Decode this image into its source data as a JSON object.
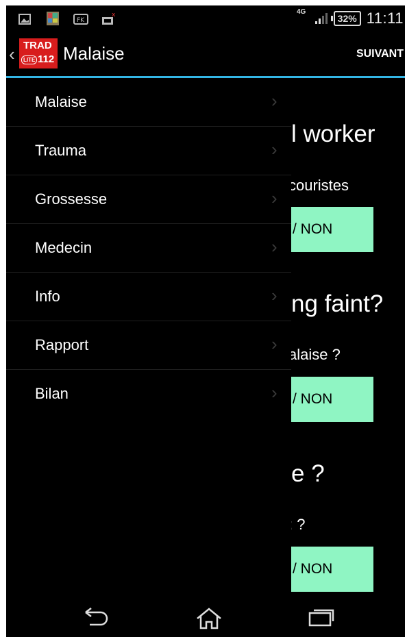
{
  "status_bar": {
    "network_type": "4G",
    "battery": "32%",
    "time": "11:11",
    "icons": [
      "image-icon",
      "gallery-icon",
      "fk-app-icon",
      "camera-error-icon",
      "signal-icon"
    ]
  },
  "action_bar": {
    "logo_top": "TRAD",
    "logo_lite": "LITE",
    "logo_number": "112",
    "title": "Malaise",
    "next_label": "SUIVANT"
  },
  "drawer": {
    "items": [
      {
        "label": "Malaise"
      },
      {
        "label": "Trauma"
      },
      {
        "label": "Grossesse"
      },
      {
        "label": "Medecin"
      },
      {
        "label": "Info"
      },
      {
        "label": "Rapport"
      },
      {
        "label": "Bilan"
      }
    ]
  },
  "content": {
    "questions": [
      {
        "title": "l worker",
        "subtitle": "couristes",
        "button": "/ NON"
      },
      {
        "title": "ng faint?",
        "subtitle": "alaise ?",
        "button": "/ NON"
      },
      {
        "title": "e ?",
        "subtitle": "; ?",
        "button": "/ NON"
      }
    ]
  },
  "nav_bar": {
    "icons": [
      "back-icon",
      "home-icon",
      "recents-icon"
    ]
  },
  "colors": {
    "accent": "#33b5e5",
    "answer_button": "#8ff5c3",
    "logo_red": "#d81d1d"
  }
}
